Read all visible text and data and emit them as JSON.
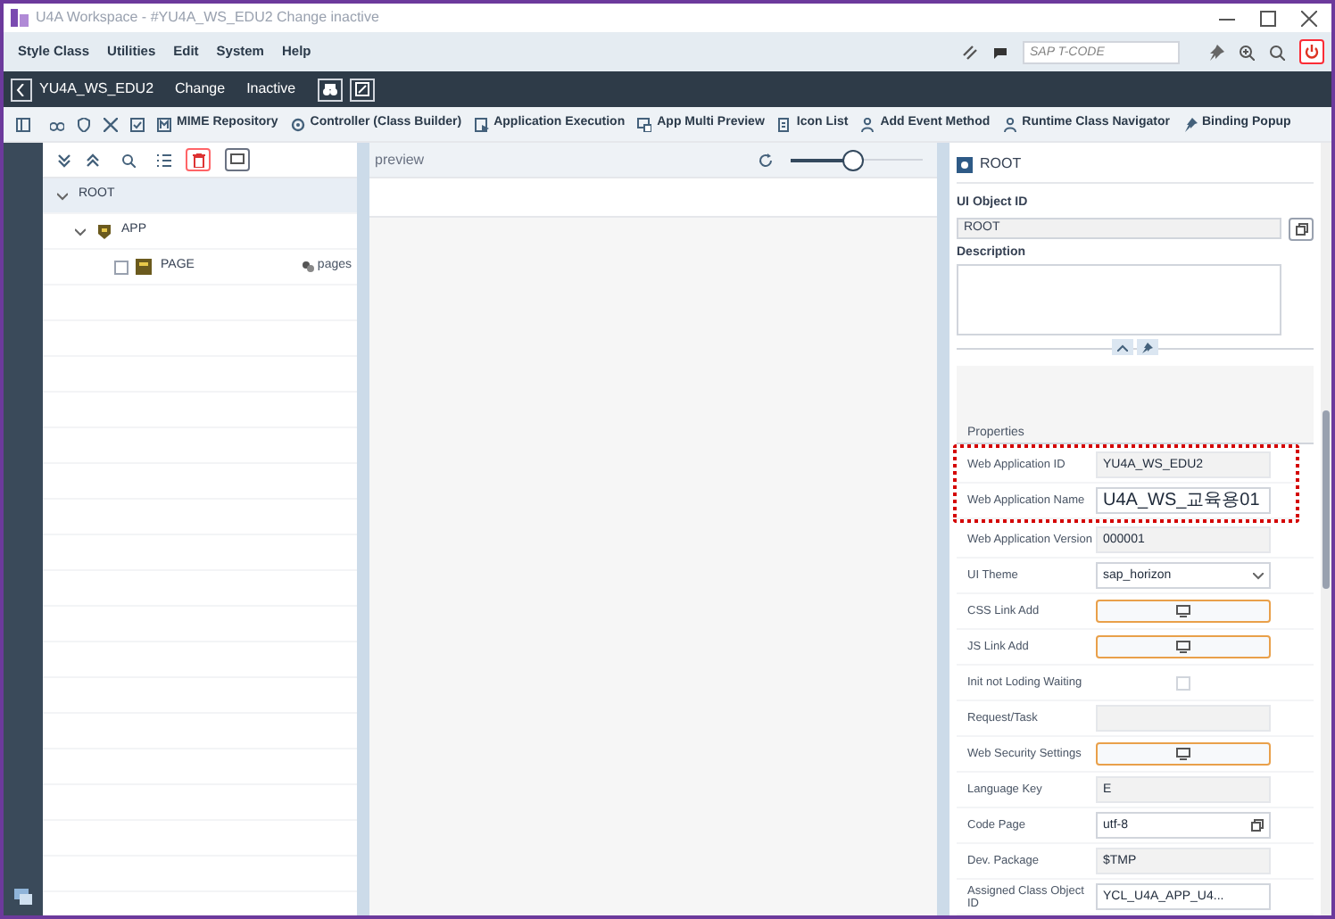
{
  "window": {
    "title": "U4A Workspace - #YU4A_WS_EDU2 Change inactive"
  },
  "menu": [
    "Style Class",
    "Utilities",
    "Edit",
    "System",
    "Help"
  ],
  "tcode": {
    "placeholder": "SAP T-CODE"
  },
  "nav": {
    "app": "YU4A_WS_EDU2",
    "mode": "Change",
    "status": "Inactive"
  },
  "toolbar": [
    {
      "kind": "icon"
    },
    {
      "kind": "icon"
    },
    {
      "kind": "icon"
    },
    {
      "kind": "icon"
    },
    {
      "kind": "labeled",
      "label": "MIME Repository"
    },
    {
      "kind": "labeled",
      "label": "Controller (Class Builder)"
    },
    {
      "kind": "labeled",
      "label": "Application Execution"
    },
    {
      "kind": "labeled",
      "label": "App Multi Preview"
    },
    {
      "kind": "labeled",
      "label": "Icon List"
    },
    {
      "kind": "labeled",
      "label": "Add Event Method"
    },
    {
      "kind": "labeled",
      "label": "Runtime Class Navigator"
    },
    {
      "kind": "labeled",
      "label": "Binding Popup"
    }
  ],
  "tree": [
    {
      "label": "ROOT",
      "selected": true,
      "expanded": true,
      "children": [
        {
          "label": "APP",
          "selected": false,
          "expanded": true,
          "children": [
            {
              "label": "PAGE",
              "selected": false,
              "checked": false,
              "type": "pages"
            }
          ]
        }
      ]
    }
  ],
  "preview": {
    "title": "preview",
    "zoom": {
      "level": 0.47
    }
  },
  "detail": {
    "title": "ROOT",
    "object_id_label": "UI Object ID",
    "object_id": "ROOT",
    "description_label": "Description",
    "properties_title": "Properties",
    "properties": [
      {
        "label": "Web Application ID",
        "kind": "input",
        "value": "YU4A_WS_EDU2",
        "editable": false,
        "highlighted": true
      },
      {
        "label": "Web Application Name",
        "kind": "input",
        "value": "U4A_WS_교육용01",
        "editable": true,
        "highlighted": true
      },
      {
        "label": "Web Application Version",
        "kind": "input",
        "value": "000001",
        "editable": false,
        "highlighted": false
      },
      {
        "label": "UI Theme",
        "kind": "select",
        "value": "sap_horizon",
        "editable": true,
        "highlighted": false
      },
      {
        "label": "CSS Link Add",
        "kind": "button",
        "highlighted": false
      },
      {
        "label": "JS Link Add",
        "kind": "button",
        "highlighted": false
      },
      {
        "label": "Init not Loding Waiting",
        "kind": "checkbox",
        "checked": false,
        "highlighted": false
      },
      {
        "label": "Request/Task",
        "kind": "input",
        "editable": false,
        "highlighted": false
      },
      {
        "label": "Web Security Settings",
        "kind": "button",
        "highlighted": false
      },
      {
        "label": "Language Key",
        "kind": "input",
        "value": "E",
        "editable": false,
        "highlighted": false
      },
      {
        "label": "Code Page",
        "kind": "lookup",
        "value": "utf-8",
        "editable": true,
        "highlighted": false
      },
      {
        "label": "Dev. Package",
        "kind": "input",
        "value": "$TMP",
        "editable": false,
        "highlighted": false
      },
      {
        "label": "Assigned Class Object ID",
        "kind": "input",
        "value": "YCL_U4A_APP_U4...",
        "editable": true,
        "highlighted": false
      }
    ]
  }
}
